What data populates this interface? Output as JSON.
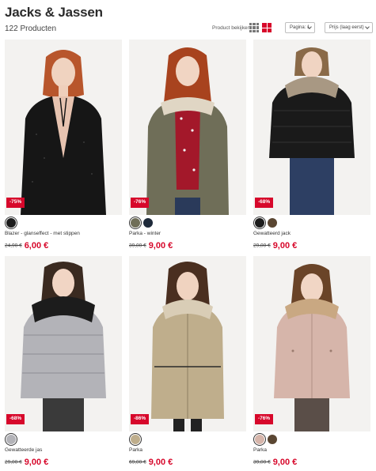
{
  "header": {
    "title": "Jacks & Jassen",
    "count": "122 Producten",
    "view_label": "Product bekijken",
    "page_select": "Pagina: 1",
    "sort_select": "Prijs (laag eerst)"
  },
  "colors": {
    "accent": "#d7082b"
  },
  "products": [
    {
      "discount": "-75%",
      "name": "Blazer - glanseffect - met stippen",
      "old_price": "24,90 €",
      "price": "6,00 €",
      "swatches": [
        "#1c1c1c"
      ],
      "image": "woman-velvet-blazer"
    },
    {
      "discount": "-76%",
      "name": "Parka - winter",
      "old_price": "39,00 €",
      "price": "9,00 €",
      "swatches": [
        "#6f6e58",
        "#1e2a3a"
      ],
      "image": "woman-khaki-parka"
    },
    {
      "discount": "-68%",
      "name": "Gewatteerd jack",
      "old_price": "29,00 €",
      "price": "9,00 €",
      "swatches": [
        "#1c1c1c",
        "#5a4632"
      ],
      "image": "woman-black-puffer"
    },
    {
      "discount": "-68%",
      "name": "Gewatteerde jas",
      "old_price": "29,00 €",
      "price": "9,00 €",
      "swatches": [
        "#b3b3b8"
      ],
      "image": "woman-grey-puffer"
    },
    {
      "discount": "-86%",
      "name": "Parka",
      "old_price": "69,00 €",
      "price": "9,00 €",
      "swatches": [
        "#bfae8c"
      ],
      "image": "woman-beige-parka"
    },
    {
      "discount": "-76%",
      "name": "Parka",
      "old_price": "39,00 €",
      "price": "9,00 €",
      "swatches": [
        "#d6b5aa",
        "#5a4632"
      ],
      "image": "woman-pink-parka"
    }
  ]
}
